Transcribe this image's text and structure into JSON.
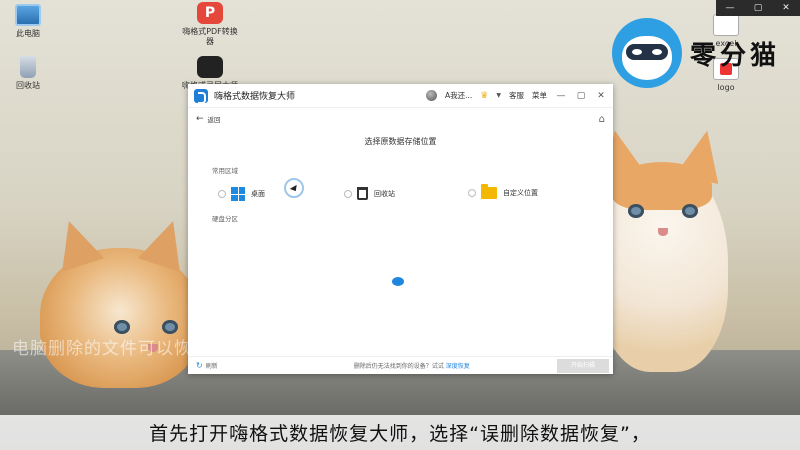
{
  "desktop": {
    "icons": [
      {
        "label": "此电脑"
      },
      {
        "label": "回收站"
      },
      {
        "label": "嗨格式PDF转换器"
      },
      {
        "label": "嗨格式录屏大师"
      },
      {
        "label": "excel"
      },
      {
        "label": "logo"
      }
    ],
    "brand_text": "零分猫",
    "ghost_caption": "电脑删除的文件可以恢复吗"
  },
  "player": {
    "controls": [
      "—",
      "▢",
      "✕"
    ]
  },
  "app": {
    "title": "嗨格式数据恢复大师",
    "account": "A我还...",
    "service": "客服",
    "menu": "菜单",
    "back_label": "返回",
    "heading": "选择原数据存储位置",
    "common_section": "常用区域",
    "locations": [
      {
        "label": "桌面",
        "icon": "windows-icon"
      },
      {
        "label": "回收站",
        "icon": "recycle-bin-icon"
      },
      {
        "label": "自定义位置",
        "icon": "folder-icon"
      }
    ],
    "disk_section": "硬盘分区",
    "bottom": {
      "refresh": "刷新",
      "hint": "删除后仍无法找到你的设备？试试",
      "hint_link": "深度恢复",
      "next_button": "开始扫描"
    }
  },
  "subtitle": "首先打开嗨格式数据恢复大师，选择“误删除数据恢复”，"
}
